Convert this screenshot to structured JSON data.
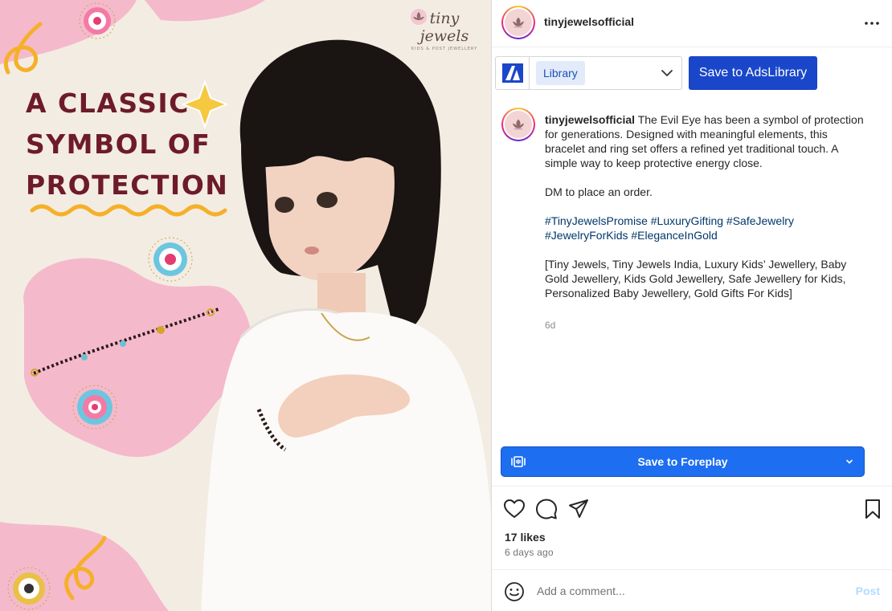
{
  "post_image": {
    "headline": [
      "A CLASSIC",
      "SYMBOL OF",
      "PROTECTION"
    ],
    "brand_name": "tiny jewels",
    "brand_tagline": "KIDS & POST JEWELLERY",
    "colors": {
      "headline": "#6d1b2a",
      "pink_blob": "#f5b9cc",
      "squiggle": "#f5b02a",
      "background": "#f3ece2"
    }
  },
  "header": {
    "username": "tinyjewelsofficial",
    "more_icon": "more-horizontal-icon"
  },
  "ads_library": {
    "selected_library": "Library",
    "save_button": "Save to AdsLibrary"
  },
  "caption": {
    "username": "tinyjewelsofficial",
    "text": "The Evil Eye has been a symbol of protection for generations. Designed with meaningful elements, this bracelet and ring set offers a refined yet traditional touch. A simple way to keep protective energy close.",
    "cta": "DM to place an order.",
    "hashtags": [
      "#TinyJewelsPromise",
      "#LuxuryGifting",
      "#SafeJewelry",
      "#JewelryForKids",
      "#EleganceInGold"
    ],
    "keywords": "[Tiny Jewels, Tiny Jewels India, Luxury Kids’ Jewellery, Baby Gold Jewellery, Kids Gold Jewellery, Safe Jewellery for Kids, Personalized Baby Jewellery, Gold Gifts For Kids]",
    "time": "6d"
  },
  "foreplay": {
    "label": "Save to Foreplay"
  },
  "actions": {
    "like_icon": "heart-icon",
    "comment_icon": "comment-icon",
    "share_icon": "share-icon",
    "save_icon": "bookmark-icon"
  },
  "stats": {
    "likes": "17 likes",
    "posted": "6 days ago"
  },
  "comment": {
    "placeholder": "Add a comment...",
    "post_label": "Post"
  },
  "accent_colors": {
    "ads_blue": "#1a47c9",
    "foreplay_blue": "#1d6ef0",
    "hashtag": "#00376b"
  }
}
